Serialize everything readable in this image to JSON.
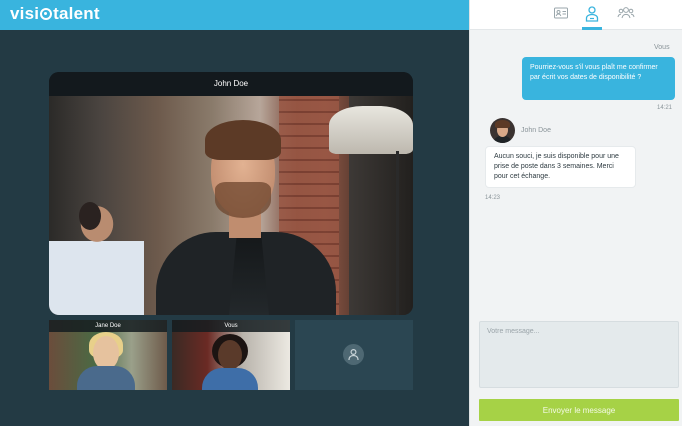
{
  "brand": {
    "logo_text_before": "visi",
    "logo_text_after": "talent"
  },
  "colors": {
    "accent": "#39b4de",
    "send_button": "#a6d246",
    "main_bg": "#233a44"
  },
  "main_video": {
    "participant_name": "John Doe"
  },
  "thumbnails": [
    {
      "label": "Jane Doe"
    },
    {
      "label": "Vous"
    },
    {
      "label": "",
      "icon": "add-participant-icon"
    }
  ],
  "tabs": [
    {
      "icon": "contact-card-icon",
      "active": false
    },
    {
      "icon": "profile-icon",
      "active": true
    },
    {
      "icon": "group-icon",
      "active": false
    }
  ],
  "chat": {
    "messages": [
      {
        "sender": "Vous",
        "text": "Pourriez-vous s'il vous plaît me confirmer par écrit vos dates de disponibilité ?",
        "time": "14:21"
      },
      {
        "sender": "John Doe",
        "text": "Aucun souci, je suis disponible pour une prise de poste dans 3 semaines. Merci pour cet échange.",
        "time": "14:23"
      }
    ],
    "input_placeholder": "Votre message...",
    "send_label": "Envoyer le message"
  }
}
